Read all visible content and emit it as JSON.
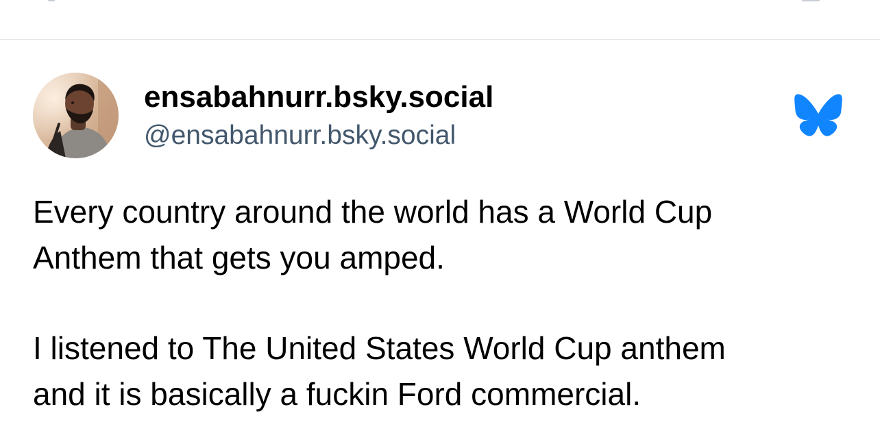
{
  "post": {
    "author": {
      "display_name": "ensabahnurr.bsky.social",
      "handle": "@ensabahnurr.bsky.social",
      "avatar": "profile-photo"
    },
    "logo_icon": "bluesky-butterfly-icon",
    "text": {
      "paragraph_1_line_1": "Every country around the world has a World Cup",
      "paragraph_1_line_2": "Anthem that gets you amped.",
      "paragraph_2_line_1": "I listened to The United States World Cup anthem",
      "paragraph_2_line_2": "and it is basically a fuckin Ford commercial."
    }
  },
  "colors": {
    "brand": "#1185fe",
    "handle": "#42576c",
    "divider": "#e3e6ea",
    "text": "#000000"
  }
}
